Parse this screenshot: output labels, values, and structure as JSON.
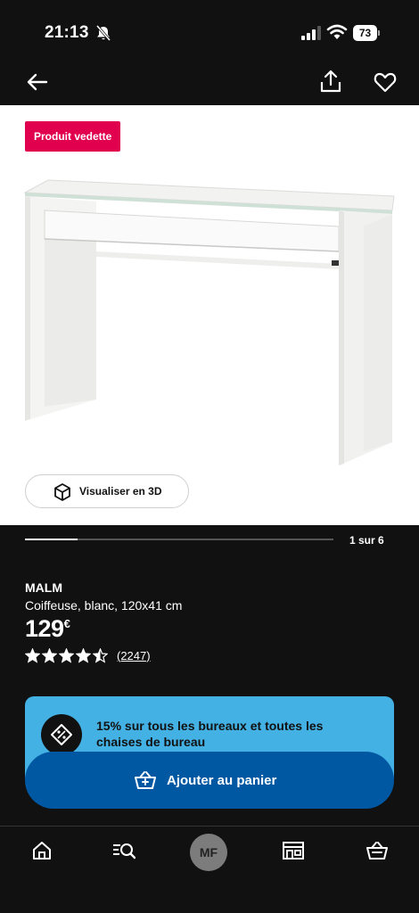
{
  "status_bar": {
    "time": "21:13",
    "battery": "73",
    "icons": [
      "bell-slash-icon",
      "signal-icon",
      "wifi-icon",
      "battery-icon"
    ]
  },
  "top_nav": {
    "icons": [
      "back-arrow-icon",
      "share-icon",
      "heart-icon"
    ]
  },
  "product_image": {
    "badge": "Produit vedette",
    "view3d_label": "Visualiser en 3D",
    "carousel_label": "1 sur 6",
    "carousel_progress": 0.17
  },
  "product": {
    "name": "MALM",
    "description": "Coiffeuse, blanc, 120x41 cm",
    "price": "129",
    "currency": "€",
    "rating": 4.5,
    "review_count": "(2247)"
  },
  "promo": {
    "text": "15% sur tous les bureaux et toutes les chaises de bureau",
    "icon": "discount-tag-icon"
  },
  "cart_button": {
    "label": "Ajouter au panier"
  },
  "bottom_nav": {
    "avatar_initials": "MF",
    "icons": [
      "home-icon",
      "search-list-icon",
      "store-icon",
      "basket-icon"
    ]
  },
  "colors": {
    "badge": "#e0004d",
    "promo": "#43b1e4",
    "cart_button": "#0058a3",
    "background": "#111111"
  }
}
